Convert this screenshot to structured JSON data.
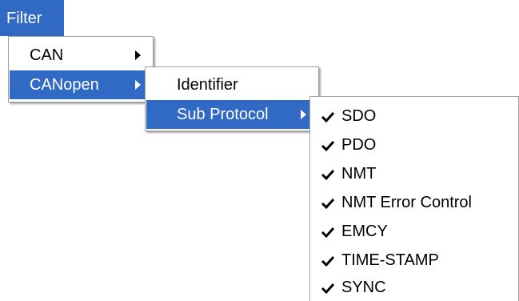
{
  "menubar": {
    "filter_label": "Filter"
  },
  "filter_menu": {
    "items": [
      {
        "label": "CAN"
      },
      {
        "label": "CANopen"
      }
    ]
  },
  "canopen_menu": {
    "items": [
      {
        "label": "Identifier"
      },
      {
        "label": "Sub Protocol"
      }
    ]
  },
  "subprotocol_menu": {
    "items": [
      {
        "label": "SDO",
        "checked": true
      },
      {
        "label": "PDO",
        "checked": true
      },
      {
        "label": "NMT",
        "checked": true
      },
      {
        "label": "NMT Error Control",
        "checked": true
      },
      {
        "label": "EMCY",
        "checked": true
      },
      {
        "label": "TIME-STAMP",
        "checked": true
      },
      {
        "label": "SYNC",
        "checked": true
      }
    ]
  },
  "colors": {
    "highlight": "#316ac5",
    "highlight_text": "#ffffff",
    "menu_bg": "#ffffff",
    "text": "#000000"
  },
  "icons": {
    "submenu_arrow": "chevron-right-icon",
    "checkmark": "checkmark-icon"
  }
}
